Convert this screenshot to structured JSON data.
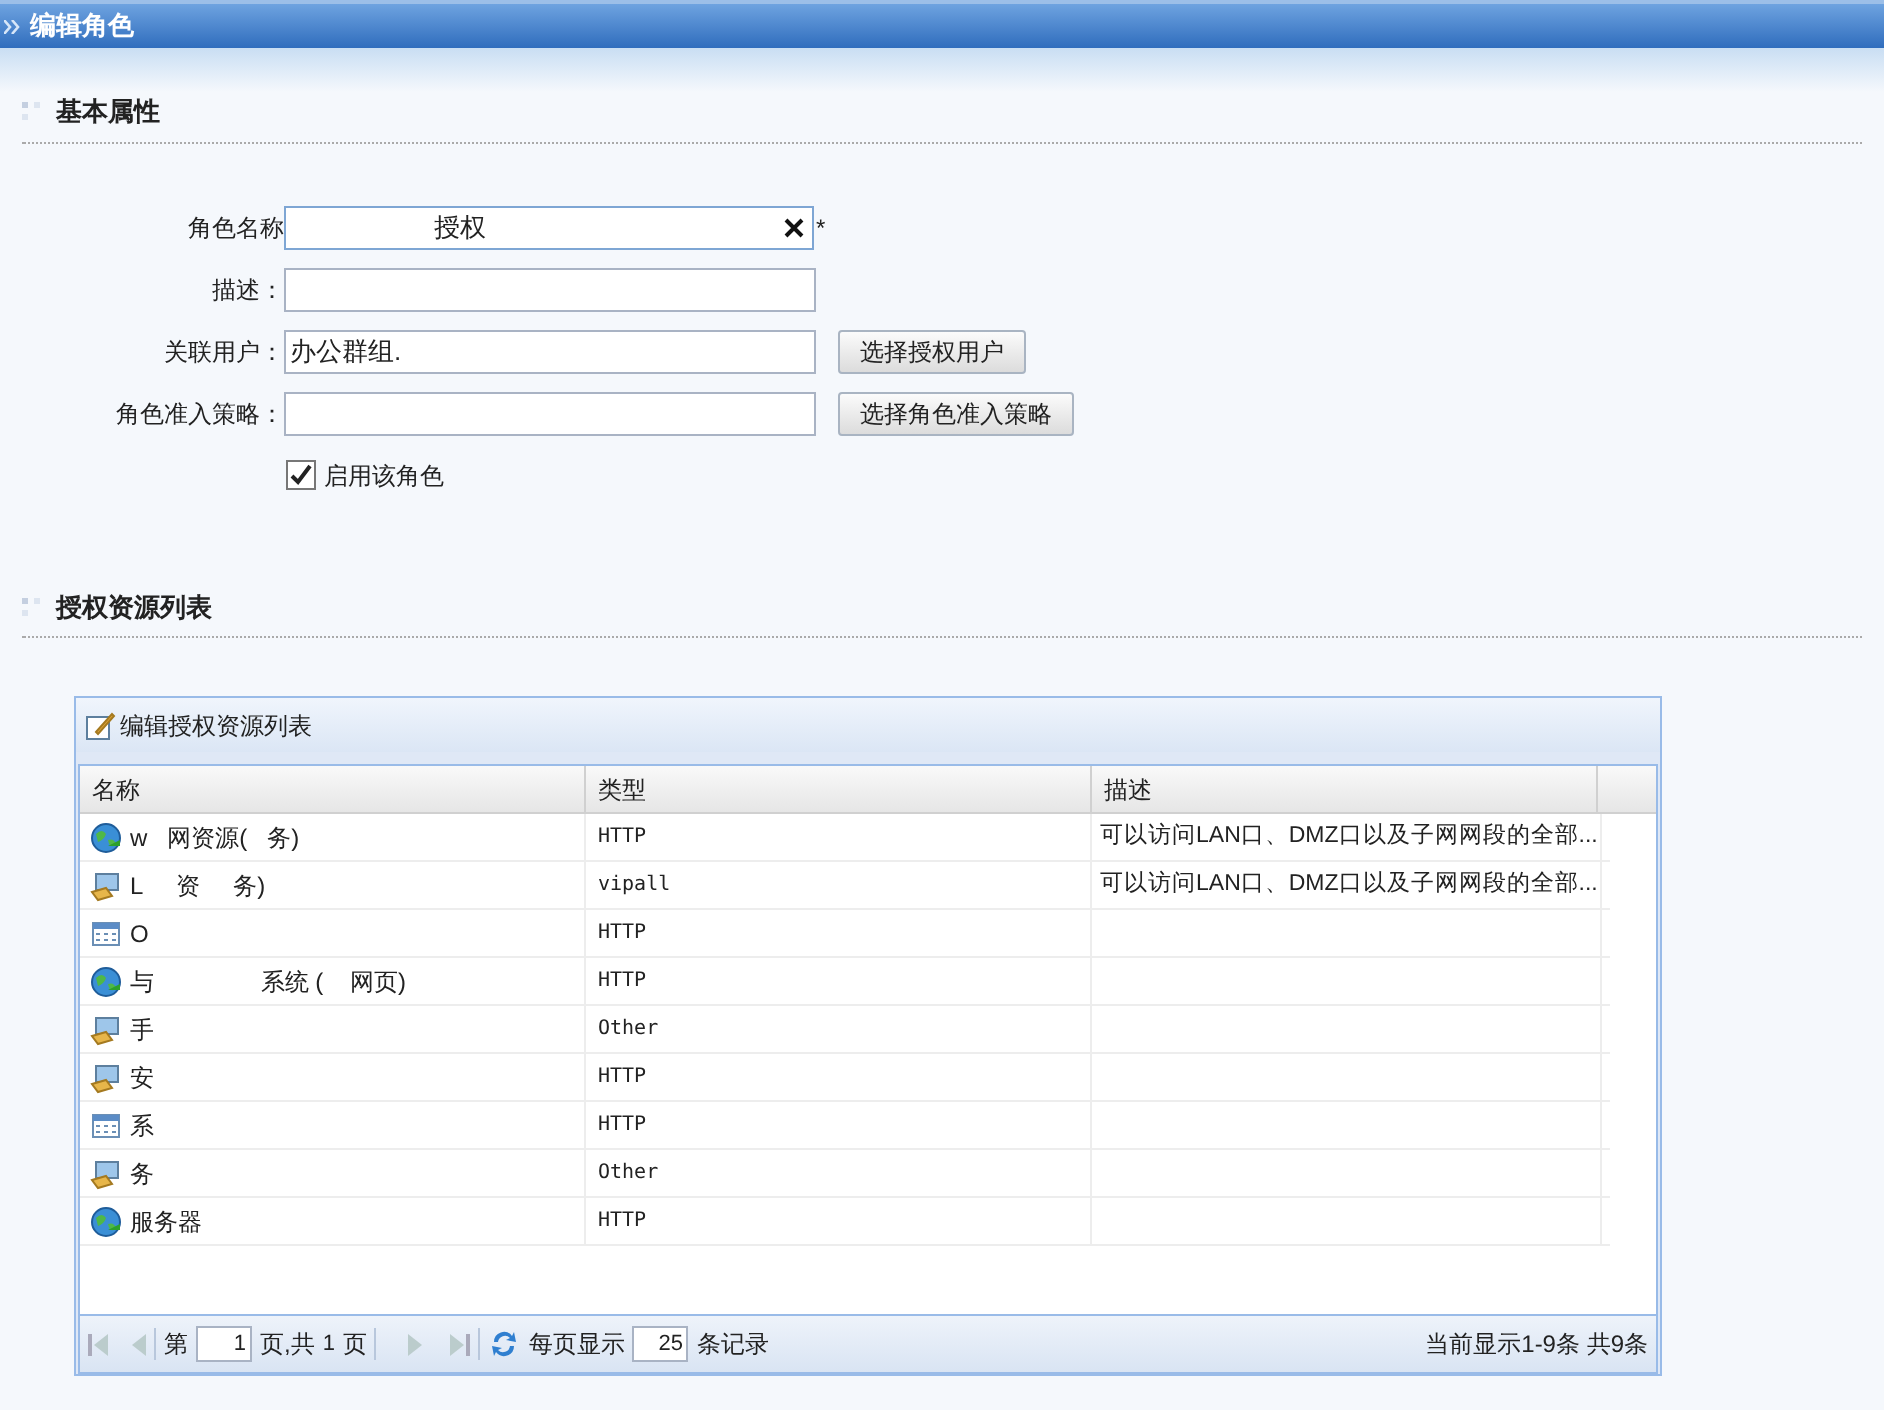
{
  "window": {
    "title": "编辑角色"
  },
  "basic_section": {
    "title": "基本属性",
    "fields": [
      {
        "kind": "clearable",
        "label": "角色名称",
        "value": "授权",
        "required_mark": "*"
      },
      {
        "kind": "text",
        "label": "描述："
      },
      {
        "kind": "button",
        "label": "关联用户：",
        "value": "办公群组.",
        "button": "选择授权用户"
      },
      {
        "kind": "button",
        "label": "角色准入策略：",
        "button": "选择角色准入策略"
      }
    ],
    "checkbox": {
      "label": "启用该角色",
      "checked": true
    }
  },
  "resource_section": {
    "title": "授权资源列表",
    "panel": {
      "title": "编辑授权资源列表",
      "table": {
        "columns": [
          "名称",
          "类型",
          "描述"
        ],
        "rows": [
          {
            "kind": "globe",
            "name": "w   网资源(   务)",
            "type": "HTTP",
            "description": "可以访问LAN口、DMZ口以及子网网段的全部..."
          },
          {
            "kind": "monitor",
            "name": "L     资     务)",
            "type": "vipall",
            "description": "可以访问LAN口、DMZ口以及子网网段的全部..."
          },
          {
            "kind": "grid",
            "name": "O",
            "type": "HTTP"
          },
          {
            "kind": "globe",
            "name": "与                系统 (    网页)",
            "type": "HTTP"
          },
          {
            "kind": "monitor",
            "name": "手",
            "type": "Other"
          },
          {
            "kind": "monitor",
            "name": "安",
            "type": "HTTP"
          },
          {
            "kind": "grid",
            "name": "系",
            "type": "HTTP"
          },
          {
            "kind": "monitor",
            "name": "务",
            "type": "Other"
          },
          {
            "kind": "globe",
            "name": "服务器",
            "type": "HTTP"
          }
        ]
      },
      "pager": {
        "page_prefix": "第",
        "page": "1",
        "page_suffix": "页,共",
        "total_pages": "1",
        "pages_word": "页",
        "per_page_label": "每页显示",
        "per_page": "25",
        "records_word": "条记录",
        "summary": "当前显示1-9条 共9条"
      }
    }
  }
}
